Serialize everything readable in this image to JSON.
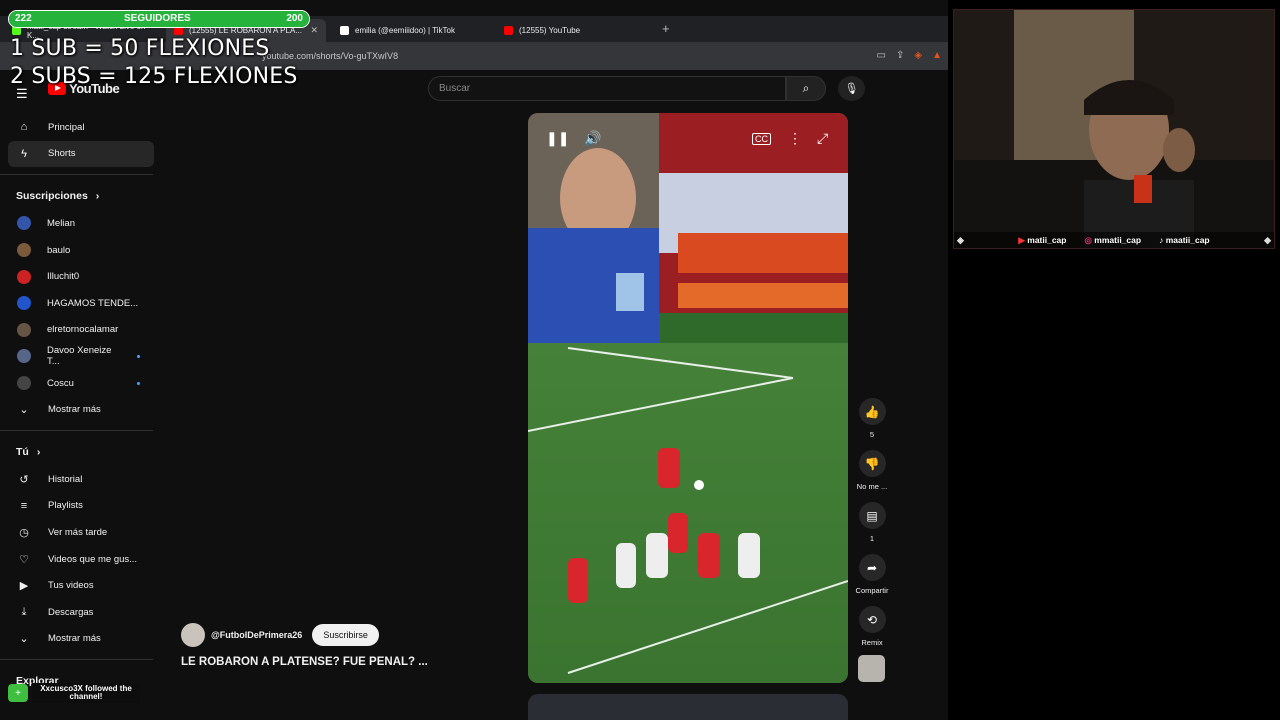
{
  "browser": {
    "tabs": [
      {
        "label": "matii_cap stream - Watch Live on K...",
        "color": "#53fc18"
      },
      {
        "label": "(12555) LE ROBARON A PLA...",
        "color": "#ff0000"
      },
      {
        "label": "emilia (@eemiiidoo) | TikTok",
        "color": "#ffffff"
      },
      {
        "label": "(12555) YouTube",
        "color": "#ff0000"
      }
    ],
    "url": "youtube.com/shorts/Vo-guTXwIV8"
  },
  "youtube": {
    "logo": "YouTube",
    "search_placeholder": "Buscar",
    "nav": [
      {
        "label": "Principal",
        "icon": "home-icon",
        "glyph": "⌂"
      },
      {
        "label": "Shorts",
        "icon": "shorts-icon",
        "glyph": "ϟ"
      }
    ],
    "subscriptions_title": "Suscripciones",
    "subscriptions": [
      {
        "label": "Melian",
        "color": "#3355aa",
        "dot": false
      },
      {
        "label": "baulo",
        "color": "#7a5a3a",
        "dot": false
      },
      {
        "label": "Illuchit0",
        "color": "#cc2222",
        "dot": false
      },
      {
        "label": "HAGAMOS TENDE...",
        "color": "#2255cc",
        "dot": false
      },
      {
        "label": "elretornocalamar",
        "color": "#665544",
        "dot": false
      },
      {
        "label": "Davoo Xeneize T...",
        "color": "#556688",
        "dot": true
      },
      {
        "label": "Coscu",
        "color": "#444444",
        "dot": true
      }
    ],
    "show_more": "Mostrar más",
    "you_title": "Tú",
    "you_items": [
      {
        "label": "Historial",
        "icon": "history-icon",
        "glyph": "↺"
      },
      {
        "label": "Playlists",
        "icon": "playlists-icon",
        "glyph": "≡"
      },
      {
        "label": "Ver más tarde",
        "icon": "watch-later-icon",
        "glyph": "◷"
      },
      {
        "label": "Videos que me gus...",
        "icon": "liked-videos-icon",
        "glyph": "👍"
      },
      {
        "label": "Tus videos",
        "icon": "your-videos-icon",
        "glyph": "▶"
      },
      {
        "label": "Descargas",
        "icon": "downloads-icon",
        "glyph": "⤓"
      }
    ],
    "show_more_2": "Mostrar más",
    "explore_title": "Explorar",
    "actions": {
      "like_count": "5",
      "dislike_label": "No me ...",
      "comments_count": "1",
      "share_label": "Compartir",
      "remix_label": "Remix"
    },
    "channel_handle": "@FutbolDePrimera26",
    "subscribe_label": "Suscribirse",
    "video_title": "LE ROBARON A PLATENSE? FUE PENAL? ..."
  },
  "overlay": {
    "followers_current": "222",
    "followers_label": "SEGUIDORES",
    "followers_goal": "200",
    "followers_progress": 1.0,
    "line1": "1 SUB = 50 FLEXIONES",
    "line2": "2 SUBS = 125 FLEXIONES",
    "cam_socials": [
      "matii_cap",
      "mmatii_cap",
      "maatii_cap"
    ],
    "follow_alert": "Xxcusco3X followed the channel!"
  },
  "colors": {
    "youtube_red": "#ff0000",
    "follower_green": "#25b33c",
    "accent_blue": "#3ea6ff"
  }
}
